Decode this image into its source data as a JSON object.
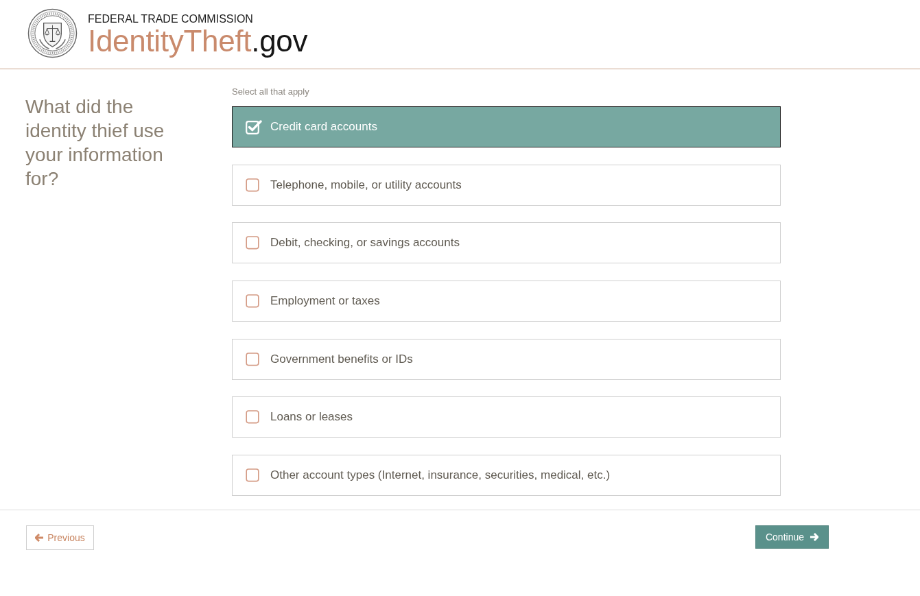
{
  "header": {
    "agency": "FEDERAL TRADE COMMISSION",
    "site_name": "IdentityTheft",
    "site_suffix": ".gov"
  },
  "question": "What did the identity thief use your information for?",
  "instruction": "Select all that apply",
  "options": [
    {
      "label": "Credit card accounts",
      "checked": true
    },
    {
      "label": "Telephone, mobile, or utility accounts",
      "checked": false
    },
    {
      "label": "Debit, checking, or savings accounts",
      "checked": false
    },
    {
      "label": "Employment or taxes",
      "checked": false
    },
    {
      "label": "Government benefits or IDs",
      "checked": false
    },
    {
      "label": "Loans or leases",
      "checked": false
    },
    {
      "label": "Other account types (Internet, insurance, securities, medical, etc.)",
      "checked": false
    }
  ],
  "navigation": {
    "previous": "Previous",
    "continue": "Continue"
  }
}
